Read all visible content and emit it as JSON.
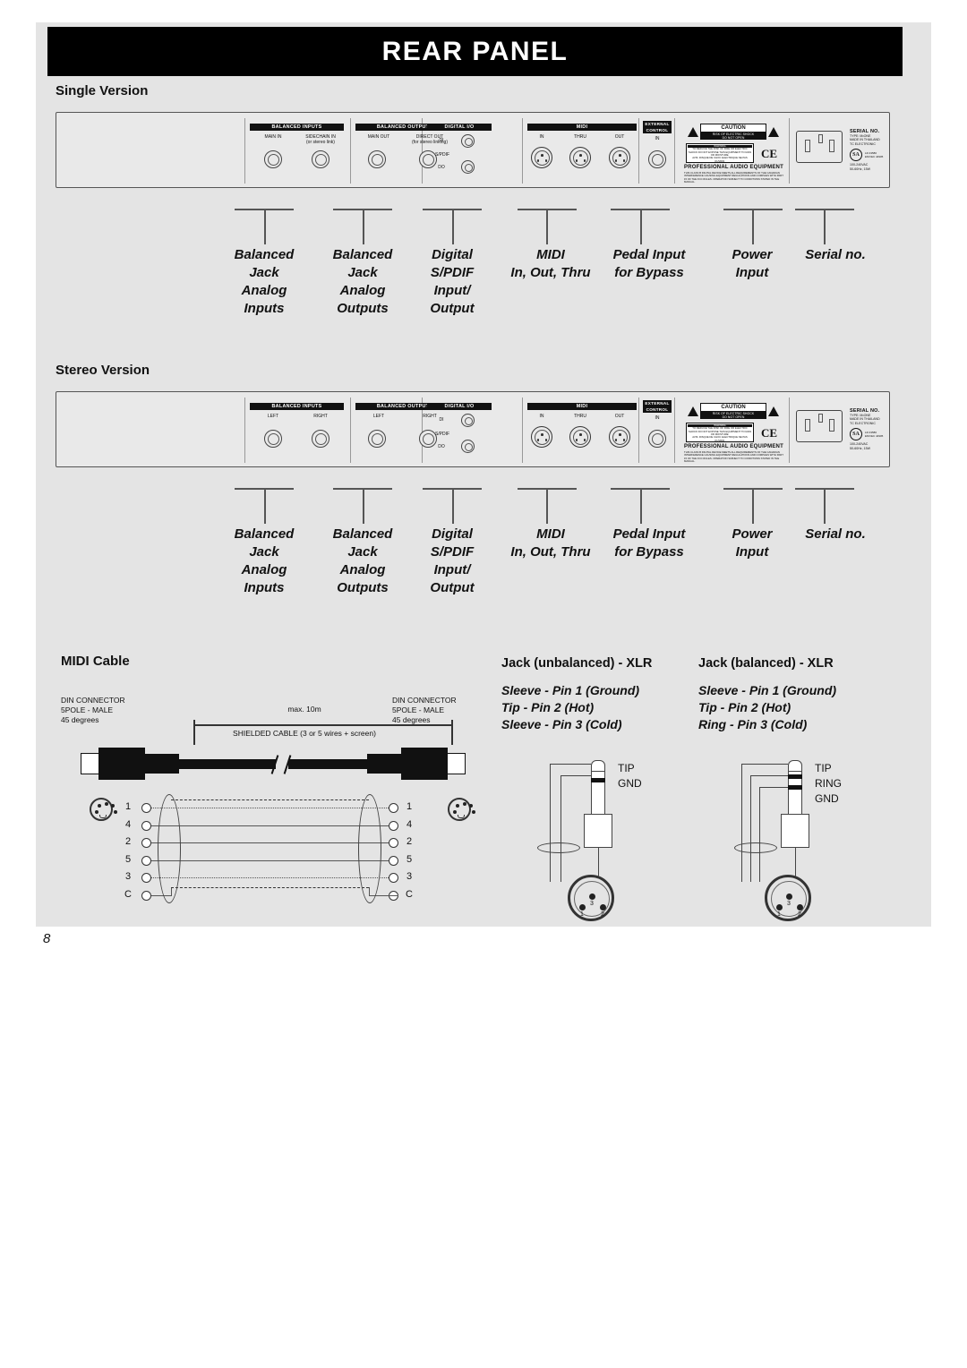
{
  "header": {
    "title": "REAR PANEL"
  },
  "page_number": "8",
  "sections": {
    "single": {
      "heading": "Single Version"
    },
    "stereo": {
      "heading": "Stereo Version"
    },
    "midi_cable": {
      "heading": "MIDI Cable"
    }
  },
  "panel_single": {
    "balanced_inputs": {
      "header": "BALANCED INPUTS",
      "left": "MAIN IN",
      "right": "SIDECHAIN IN",
      "right_sub": "(or stereo link)"
    },
    "balanced_outputs": {
      "header": "BALANCED OUTPUTS",
      "left": "MAIN OUT",
      "right": "DIRECT OUT",
      "right_sub": "(for stereo linking)"
    },
    "digital_io": {
      "header": "DIGITAL I/O",
      "di": "DI",
      "spdif": "S/PDIF",
      "do": "DO"
    },
    "midi": {
      "header": "MIDI",
      "in": "IN",
      "thru": "THRU",
      "out": "OUT"
    },
    "external_control": {
      "header1": "EXTERNAL",
      "header2": "CONTROL",
      "in": "IN"
    }
  },
  "panel_stereo": {
    "balanced_inputs": {
      "header": "BALANCED INPUTS",
      "left": "LEFT",
      "right": "RIGHT"
    },
    "balanced_outputs": {
      "header": "BALANCED OUTPUTS",
      "left": "LEFT",
      "right": "RIGHT"
    },
    "digital_io": {
      "header": "DIGITAL I/O",
      "di": "DI",
      "spdif": "S/PDIF",
      "do": "DO"
    },
    "midi": {
      "header": "MIDI",
      "in": "IN",
      "thru": "THRU",
      "out": "OUT"
    },
    "external_control": {
      "header1": "EXTERNAL",
      "header2": "CONTROL",
      "in": "IN"
    }
  },
  "agency": {
    "caution": "CAUTION",
    "caution_sub": "RISK OF ELECTRIC SHOCK\nDO NOT OPEN",
    "warning_title": "WARNING",
    "warning_body": "TO REDUCE THE RISK OF FIRE OR ELECTRIC SHOCK DO NOT EXPOSE THIS EQUIPMENT TO RAIN OR MOISTURE.\nAVIS: RISQUE DE CHOC ELECTRIQUE NE PAS OUVRIR.",
    "ce_mark": "CE",
    "pro_audio": "PROFESSIONAL AUDIO EQUIPMENT",
    "fcc_text": "THIS CLASS B DIGITAL DEVICE MEETS ALL REQUIREMENTS OF THE CANADIAN INTERFERENCE CAUSING EQUIPMENT REGULATIONS AND COMPLIES WITH PART 15 OF THE FCC RULES. OPERATION SUBJECT TO CONDITIONS STATED IN THE MANUAL."
  },
  "serial": {
    "title": "SERIAL NO.",
    "lines": "TYPE: M•ONE\nMADE IN THAILAND\nTC ELECTRONIC",
    "csa": "SA",
    "csa_side": "LR 43580\nENV/EC 44905",
    "voltage": "100-240VAC",
    "power": "50-60Hz, 15W"
  },
  "callouts": [
    {
      "label": "Balanced\nJack\nAnalog\nInputs"
    },
    {
      "label": "Balanced\nJack\nAnalog\nOutputs"
    },
    {
      "label": "Digital\nS/PDIF\nInput/\nOutput"
    },
    {
      "label": "MIDI\nIn, Out, Thru"
    },
    {
      "label": "Pedal Input\nfor Bypass"
    },
    {
      "label": "Power\nInput"
    },
    {
      "label": "Serial no."
    }
  ],
  "midi_cable": {
    "connector_left": "DIN CONNECTOR\n5POLE - MALE\n45 degrees",
    "connector_right": "DIN CONNECTOR\n5POLE - MALE\n45 degrees",
    "max_length": "max. 10m",
    "cable_type": "SHIELDED CABLE (3 or 5 wires + screen)",
    "pins_left": [
      "1",
      "4",
      "2",
      "5",
      "3",
      "C"
    ],
    "pins_right": [
      "1",
      "4",
      "2",
      "5",
      "3",
      "C"
    ]
  },
  "jack_unbalanced": {
    "title": "Jack (unbalanced) - XLR",
    "spec": "Sleeve - Pin 1 (Ground)\nTip - Pin 2 (Hot)\nSleeve - Pin 3 (Cold)",
    "labels": [
      "TIP",
      "GND"
    ],
    "xlr_pins": [
      "1",
      "2",
      "3"
    ]
  },
  "jack_balanced": {
    "title": "Jack (balanced) - XLR",
    "spec": "Sleeve - Pin 1 (Ground)\nTip - Pin 2 (Hot)\nRing - Pin 3 (Cold)",
    "labels": [
      "TIP",
      "RING",
      "GND"
    ],
    "xlr_pins": [
      "1",
      "2",
      "3"
    ]
  },
  "colors": {
    "background": "#e4e4e4",
    "title_bar": "#000000",
    "panel": "#e9e9e9",
    "line": "#555555"
  }
}
